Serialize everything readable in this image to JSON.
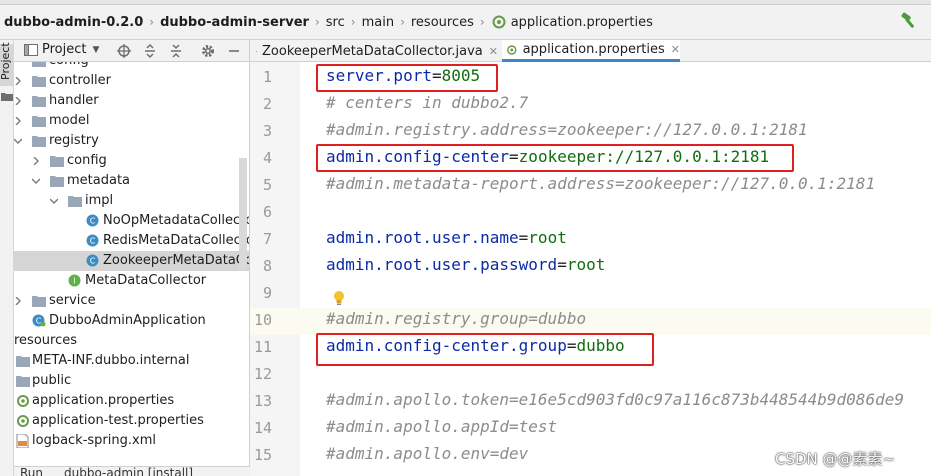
{
  "breadcrumb": {
    "items": [
      "dubbo-admin-0.2.0",
      "dubbo-admin-server",
      "src",
      "main",
      "resources",
      "application.properties"
    ]
  },
  "tool_stripe": {
    "project_label": "Project"
  },
  "project_panel": {
    "title": "Project",
    "tree": [
      {
        "label": "config",
        "kind": "folder",
        "expanded": false
      },
      {
        "label": "controller",
        "kind": "folder",
        "expanded": false
      },
      {
        "label": "handler",
        "kind": "folder",
        "expanded": false
      },
      {
        "label": "model",
        "kind": "folder",
        "expanded": false
      },
      {
        "label": "registry",
        "kind": "folder",
        "expanded": true
      },
      {
        "label": "config",
        "kind": "folder",
        "expanded": false
      },
      {
        "label": "metadata",
        "kind": "folder",
        "expanded": true
      },
      {
        "label": "impl",
        "kind": "folder",
        "expanded": true
      },
      {
        "label": "NoOpMetadataCollector",
        "kind": "class"
      },
      {
        "label": "RedisMetaDataCollector",
        "kind": "class"
      },
      {
        "label": "ZookeeperMetaDataCollector",
        "kind": "class",
        "selected": true
      },
      {
        "label": "MetaDataCollector",
        "kind": "interface"
      },
      {
        "label": "service",
        "kind": "folder",
        "expanded": false
      },
      {
        "label": "DubboAdminApplication",
        "kind": "class"
      },
      {
        "label": "resources",
        "kind": "text"
      },
      {
        "label": "META-INF.dubbo.internal",
        "kind": "folder"
      },
      {
        "label": "public",
        "kind": "folder"
      },
      {
        "label": "application.properties",
        "kind": "properties"
      },
      {
        "label": "application-test.properties",
        "kind": "properties"
      },
      {
        "label": "logback-spring.xml",
        "kind": "xml"
      }
    ]
  },
  "tabs": [
    {
      "label": "ZookeeperMetaDataCollector.java",
      "active": false
    },
    {
      "label": "application.properties",
      "active": true
    }
  ],
  "editor": {
    "lines": [
      {
        "n": "1",
        "key": "server.port",
        "val": "8005"
      },
      {
        "n": "2",
        "comment": "# centers in dubbo2.7"
      },
      {
        "n": "3",
        "comment": "#admin.registry.address=zookeeper://127.0.0.1:2181"
      },
      {
        "n": "4",
        "key": "admin.config-center",
        "val": "zookeeper://127.0.0.1:2181"
      },
      {
        "n": "5",
        "comment": "#admin.metadata-report.address=zookeeper://127.0.0.1:2181"
      },
      {
        "n": "6"
      },
      {
        "n": "7",
        "key": "admin.root.user.name",
        "val": "root"
      },
      {
        "n": "8",
        "key": "admin.root.user.password",
        "val": "root"
      },
      {
        "n": "9"
      },
      {
        "n": "10",
        "comment": "#admin.registry.group=dubbo"
      },
      {
        "n": "11",
        "key": "admin.config-center.group",
        "val": "dubbo"
      },
      {
        "n": "12"
      },
      {
        "n": "13",
        "comment": "#admin.apollo.token=e16e5cd903fd0c97a116c873b448544b9d086de9"
      },
      {
        "n": "14",
        "comment": "#admin.apollo.appId=test"
      },
      {
        "n": "15",
        "comment": "#admin.apollo.env=dev"
      }
    ]
  },
  "bottom": {
    "run_label": "Run",
    "run_config": "dubbo-admin [install]"
  },
  "watermark": "CSDN @@素素~",
  "colors": {
    "accent": "#4083c9",
    "highlight_box": "#e02020",
    "key": "#0b2aa6",
    "value": "#106d10",
    "comment": "#8c8c8c"
  }
}
